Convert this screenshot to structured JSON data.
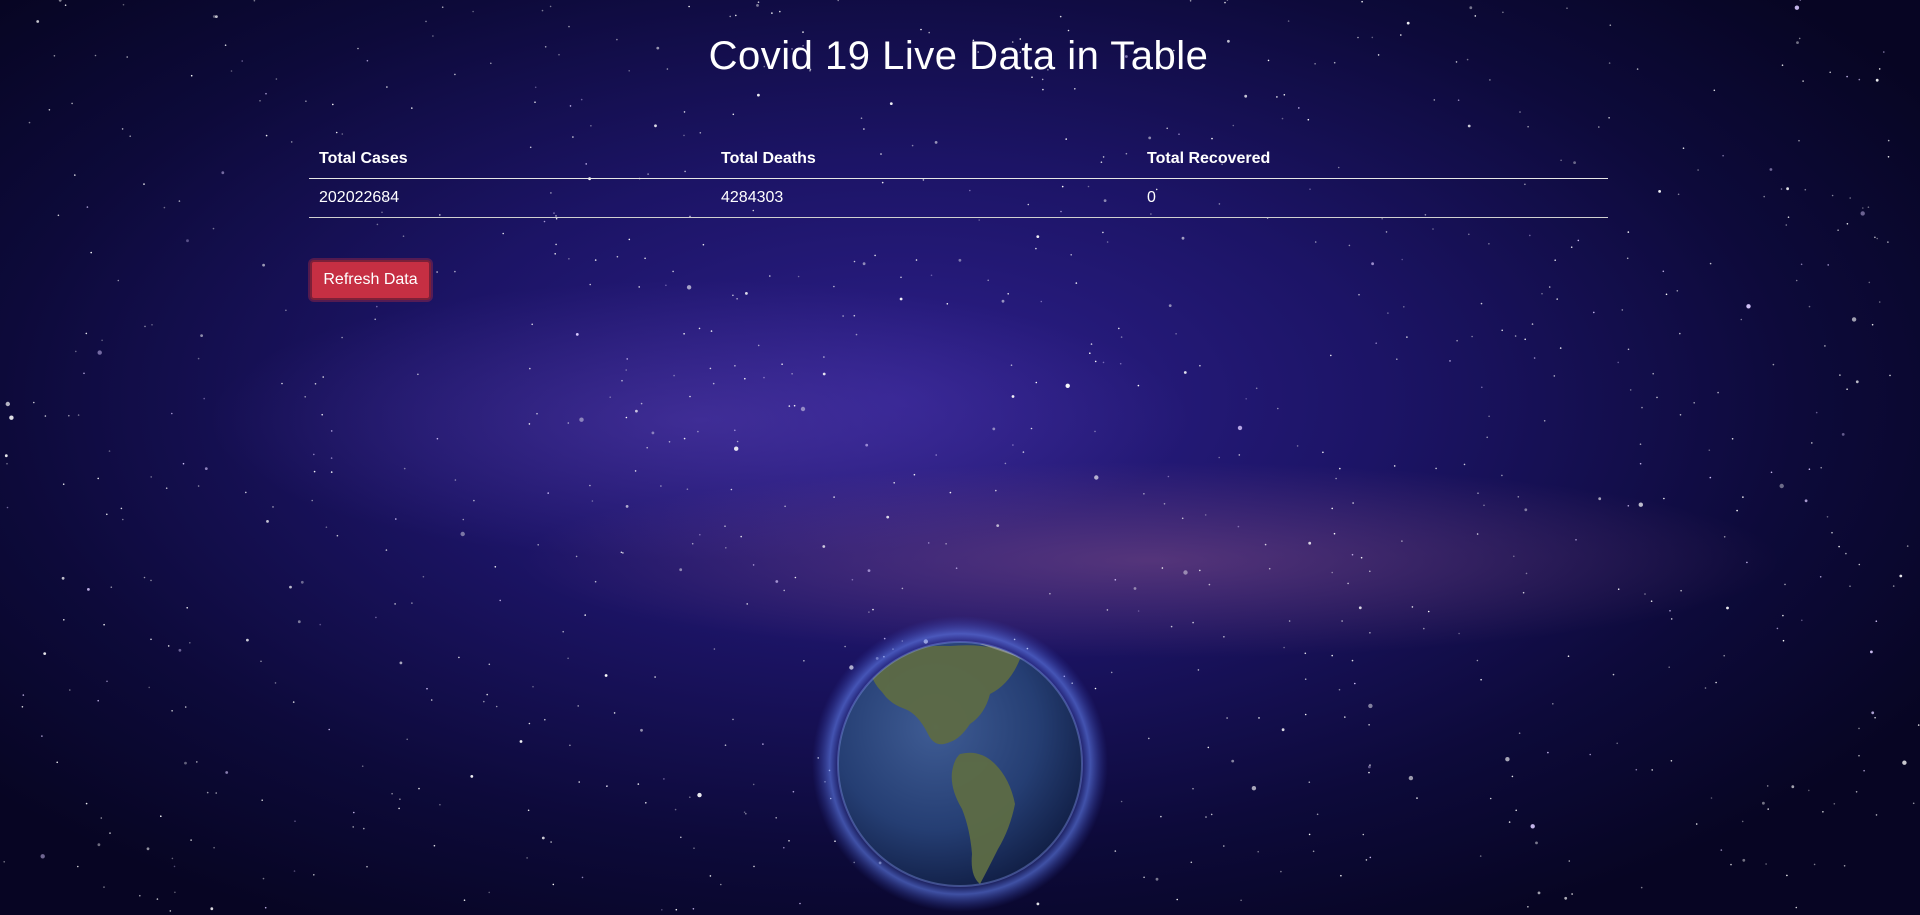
{
  "page": {
    "title": "Covid 19 Live Data in Table"
  },
  "table": {
    "headers": [
      "Total Cases",
      "Total Deaths",
      "Total Recovered"
    ],
    "rows": [
      [
        "202022684",
        "4284303",
        "0"
      ]
    ]
  },
  "actions": {
    "refresh_label": "Refresh Data"
  },
  "colors": {
    "button_bg": "#c62f43",
    "text": "#ffffff",
    "background": "#1c1466"
  }
}
